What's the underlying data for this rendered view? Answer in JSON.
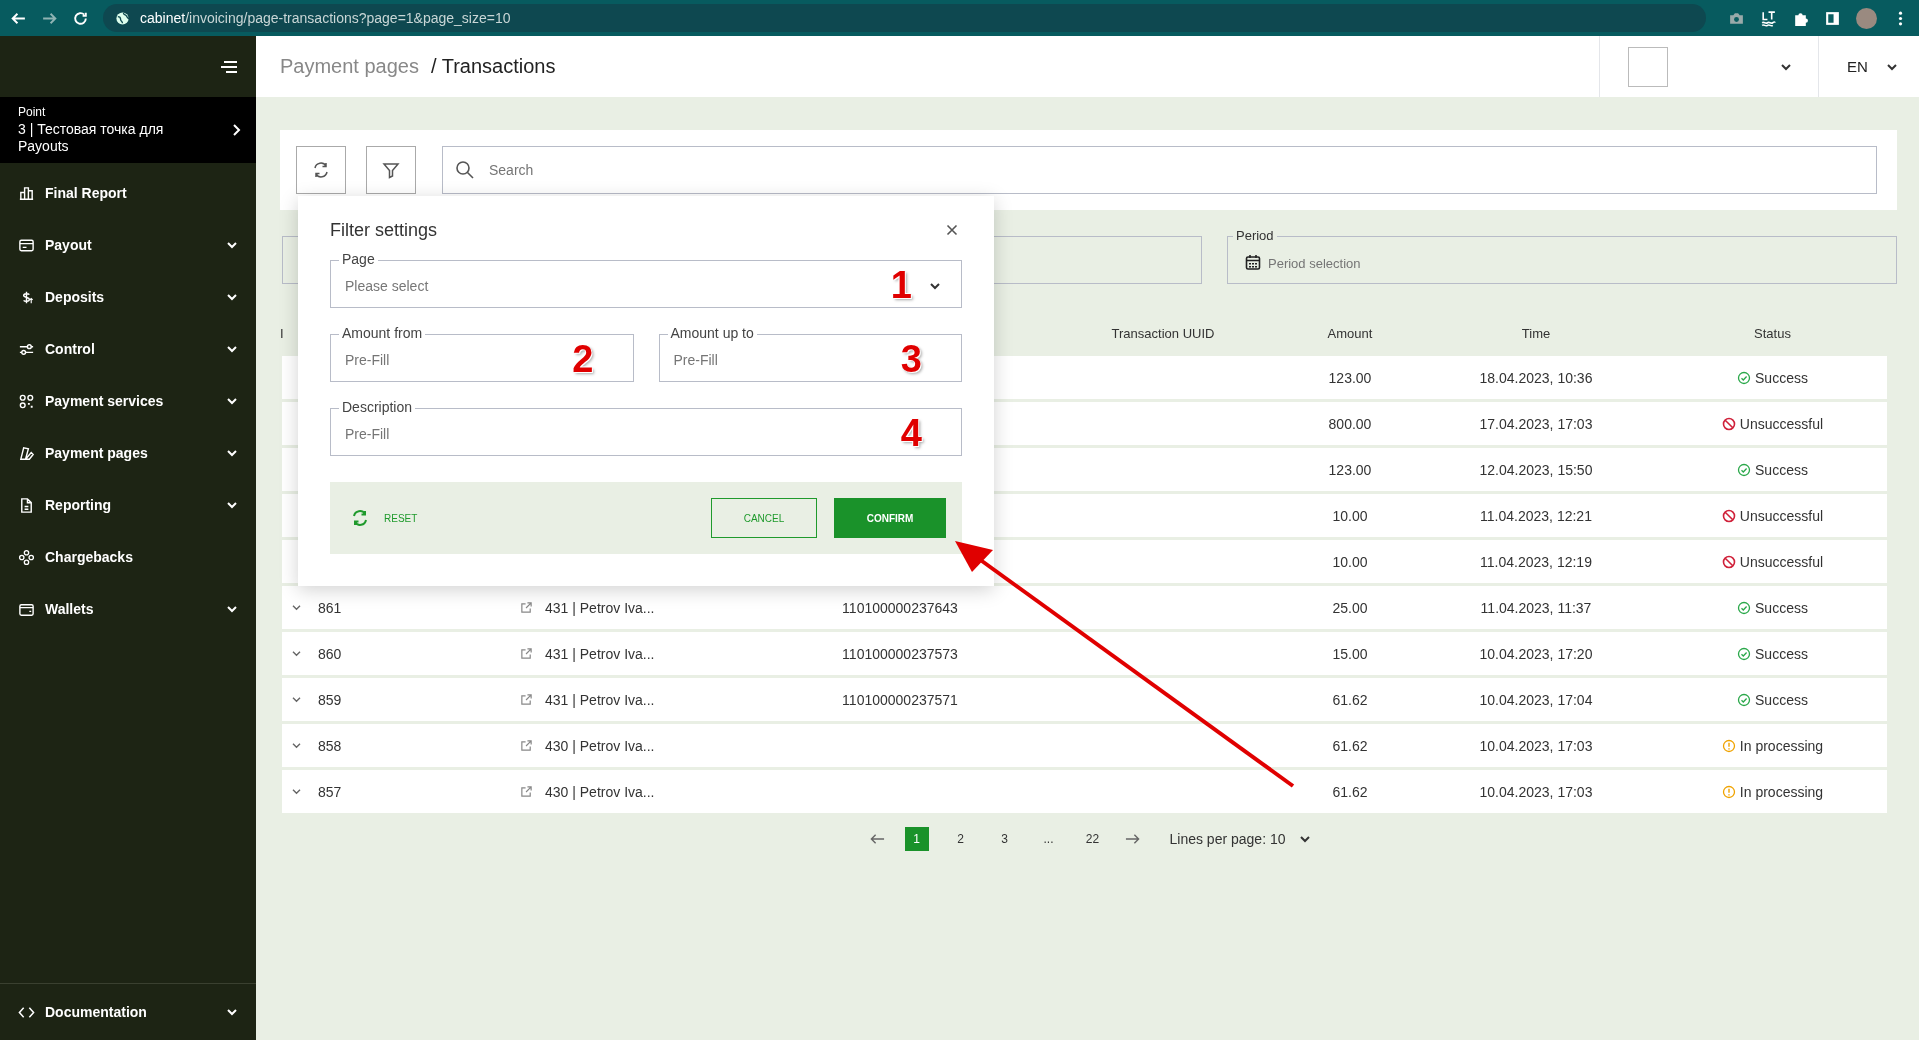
{
  "browser": {
    "url_host": "cabinet",
    "url_path": "/invoicing/page-transactions?page=1&page_size=10"
  },
  "sidebar": {
    "point": {
      "label": "Point",
      "value": "3 | Тестовая точка для Payouts"
    },
    "items": [
      {
        "label": "Final Report",
        "expandable": false
      },
      {
        "label": "Payout",
        "expandable": true
      },
      {
        "label": "Deposits",
        "expandable": true
      },
      {
        "label": "Control",
        "expandable": true
      },
      {
        "label": "Payment services",
        "expandable": true
      },
      {
        "label": "Payment pages",
        "expandable": true
      },
      {
        "label": "Reporting",
        "expandable": true
      },
      {
        "label": "Chargebacks",
        "expandable": false
      },
      {
        "label": "Wallets",
        "expandable": true
      }
    ],
    "footer": {
      "label": "Documentation",
      "expandable": true
    }
  },
  "header": {
    "breadcrumb": [
      {
        "label": "Payment pages",
        "current": false
      },
      {
        "label": "/ Transactions",
        "current": true
      }
    ],
    "language": "EN"
  },
  "toolbar": {
    "search_placeholder": "Search"
  },
  "period_filter": {
    "label": "Period",
    "placeholder": "Period selection"
  },
  "table": {
    "columns": {
      "id": "I",
      "transaction_uuid": "Transaction UUID",
      "amount": "Amount",
      "time": "Time",
      "status": "Status"
    },
    "rows": [
      {
        "amount": "123.00",
        "time": "18.04.2023, 10:36",
        "status": "Success",
        "kind": "success"
      },
      {
        "amount": "800.00",
        "time": "17.04.2023, 17:03",
        "status": "Unsuccessful",
        "kind": "failed"
      },
      {
        "amount": "123.00",
        "time": "12.04.2023, 15:50",
        "status": "Success",
        "kind": "success"
      },
      {
        "amount": "10.00",
        "time": "11.04.2023, 12:21",
        "status": "Unsuccessful",
        "kind": "failed"
      },
      {
        "amount": "10.00",
        "time": "11.04.2023, 12:19",
        "status": "Unsuccessful",
        "kind": "failed"
      },
      {
        "id": "861",
        "column_2": "431 | Petrov Iva...",
        "column_3": "110100000237643",
        "amount": "25.00",
        "time": "11.04.2023, 11:37",
        "status": "Success",
        "kind": "success"
      },
      {
        "id": "860",
        "column_2": "431 | Petrov Iva...",
        "column_3": "110100000237573",
        "amount": "15.00",
        "time": "10.04.2023, 17:20",
        "status": "Success",
        "kind": "success"
      },
      {
        "id": "859",
        "column_2": "431 | Petrov Iva...",
        "column_3": "110100000237571",
        "amount": "61.62",
        "time": "10.04.2023, 17:04",
        "status": "Success",
        "kind": "success"
      },
      {
        "id": "858",
        "column_2": "430 | Petrov Iva...",
        "amount": "61.62",
        "time": "10.04.2023, 17:03",
        "status": "In processing",
        "kind": "processing"
      },
      {
        "id": "857",
        "column_2": "430 | Petrov Iva...",
        "amount": "61.62",
        "time": "10.04.2023, 17:03",
        "status": "In processing",
        "kind": "processing"
      }
    ]
  },
  "pagination": {
    "pages": [
      {
        "label": "1",
        "selected": true
      },
      {
        "label": "2",
        "selected": false
      },
      {
        "label": "3",
        "selected": false
      },
      {
        "label": "...",
        "selected": false
      },
      {
        "label": "22",
        "selected": false
      }
    ],
    "lines_per_page": "Lines per page: 10"
  },
  "filter_dialog": {
    "title": "Filter settings",
    "field_rows": [
      [
        {
          "kind": "select",
          "label": "Page",
          "placeholder": "Please select",
          "annotation": "1"
        }
      ],
      [
        {
          "kind": "input",
          "label": "Amount from",
          "placeholder": "Pre-Fill",
          "annotation": "2"
        },
        {
          "kind": "input",
          "label": "Amount up to",
          "placeholder": "Pre-Fill",
          "annotation": "3"
        }
      ],
      [
        {
          "kind": "input",
          "label": "Description",
          "placeholder": "Pre-Fill",
          "annotation": "4"
        }
      ]
    ],
    "reset": "RESET",
    "cancel": "CANCEL",
    "confirm": "CONFIRM"
  },
  "annotation_arrow": true
}
